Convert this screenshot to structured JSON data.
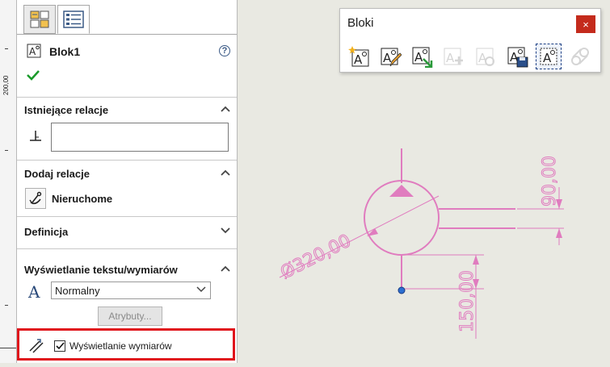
{
  "ruler": {
    "label": "200,00"
  },
  "panel": {
    "tabs": [
      {
        "name": "feature-manager",
        "icon": "feature-manager-icon"
      },
      {
        "name": "property-manager",
        "icon": "property-manager-icon",
        "active": true
      }
    ],
    "title": "Blok1",
    "help_symbol": "?",
    "sections": {
      "existing_relations": {
        "label": "Istniejące relacje",
        "expanded": true
      },
      "add_relations": {
        "label": "Dodaj relacje",
        "expanded": true,
        "item_label": "Nieruchome"
      },
      "definition": {
        "label": "Definicja",
        "expanded": false
      },
      "text_display": {
        "label": "Wyświetlanie tekstu/wymiarów",
        "expanded": true,
        "font_selected": "Normalny",
        "attributes_label": "Atrybuty...",
        "show_dimensions_label": "Wyświetlanie wymiarów",
        "show_dimensions_checked": true
      }
    }
  },
  "toolbar": {
    "title": "Bloki",
    "close_symbol": "×",
    "buttons": [
      {
        "name": "make-block",
        "icon": "make-block-icon",
        "enabled": true
      },
      {
        "name": "edit-block",
        "icon": "edit-block-icon",
        "enabled": true
      },
      {
        "name": "insert-block",
        "icon": "insert-block-icon",
        "enabled": true
      },
      {
        "name": "add-remove-block",
        "icon": "add-remove-icon",
        "enabled": false
      },
      {
        "name": "rebuild-block",
        "icon": "rebuild-icon",
        "enabled": false
      },
      {
        "name": "save-block",
        "icon": "save-block-icon",
        "enabled": true
      },
      {
        "name": "explode-block",
        "icon": "explode-block-icon",
        "enabled": true,
        "selected": true
      },
      {
        "name": "belt-chain",
        "icon": "belt-chain-icon",
        "enabled": false
      }
    ]
  },
  "drawing": {
    "dimensions": {
      "diameter": "Ø320,00",
      "right": "90,00",
      "bottom": "150,00"
    },
    "color": "#e07cbf",
    "point_color": "#2c6fd1"
  },
  "colors": {
    "highlight": "#e0141c",
    "ok_check": "#1a9a2a",
    "close_button": "#c42b1c"
  }
}
